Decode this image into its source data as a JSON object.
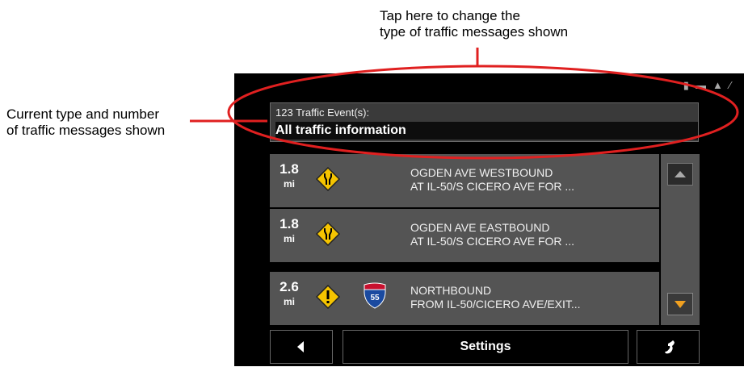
{
  "annotations": {
    "top_callout": [
      "Tap here to change the",
      "type of traffic messages shown"
    ],
    "left_callout": [
      "Current type and number",
      "of traffic messages shown"
    ]
  },
  "status_bar": {
    "icons": [
      "battery-icon",
      "card-icon",
      "warning-icon",
      "satellite-icon"
    ]
  },
  "filter": {
    "count_label": "123 Traffic Event(s):",
    "selected_type": "All traffic information"
  },
  "events": [
    {
      "distance": "1.8",
      "unit": "mi",
      "sign": "road-narrows-sign-icon",
      "shield": "",
      "line1": "OGDEN AVE WESTBOUND",
      "line2": "AT IL-50/S CICERO AVE FOR ..."
    },
    {
      "distance": "1.8",
      "unit": "mi",
      "sign": "road-narrows-sign-icon",
      "shield": "",
      "line1": "OGDEN AVE EASTBOUND",
      "line2": "AT IL-50/S CICERO AVE FOR ..."
    },
    {
      "distance": "2.6",
      "unit": "mi",
      "sign": "exclamation-warning-sign-icon",
      "shield": "55",
      "line1": "NORTHBOUND",
      "line2": "FROM IL-50/CICERO AVE/EXIT..."
    }
  ],
  "bottom_bar": {
    "settings_label": "Settings"
  },
  "colors": {
    "annotation_red": "#e02020",
    "screen_bg": "#000000",
    "row_bg": "#545454",
    "warning_yellow": "#f5c400",
    "scroll_down_orange": "#f0a020",
    "interstate_blue": "#1a4aa0",
    "interstate_red": "#c8102e"
  }
}
